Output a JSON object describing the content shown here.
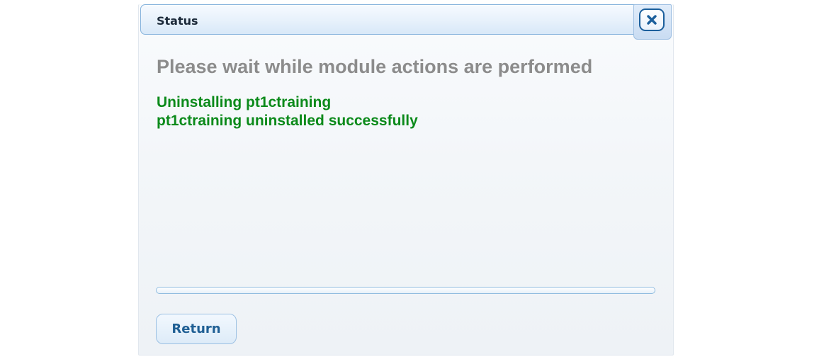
{
  "dialog": {
    "title": "Status",
    "close_icon": "close-x-icon",
    "heading": "Please wait while module actions are performed",
    "log_lines": [
      "Uninstalling pt1ctraining",
      "pt1ctraining uninstalled successfully"
    ],
    "progress_percent": 0,
    "return_label": "Return"
  },
  "colors": {
    "heading": "#8c8c8c",
    "log_text": "#0b8a1a",
    "title_border": "#86b3dc",
    "accent": "#1b5f9c"
  }
}
